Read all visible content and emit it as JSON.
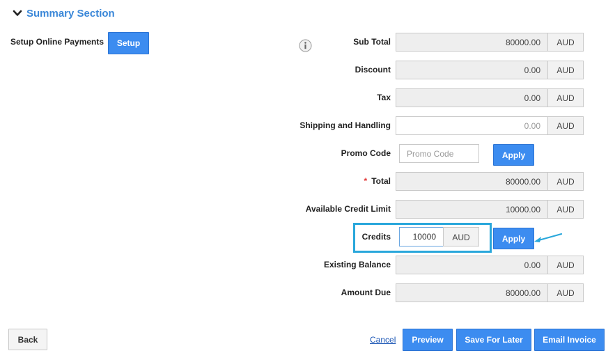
{
  "section": {
    "title": "Summary Section"
  },
  "setup": {
    "label": "Setup Online Payments",
    "button": "Setup"
  },
  "rows": {
    "sub_total": {
      "label": "Sub Total",
      "value": "80000.00",
      "unit": "AUD"
    },
    "discount": {
      "label": "Discount",
      "value": "0.00",
      "unit": "AUD"
    },
    "tax": {
      "label": "Tax",
      "value": "0.00",
      "unit": "AUD"
    },
    "shipping": {
      "label": "Shipping and Handling",
      "value": "0.00",
      "unit": "AUD"
    },
    "promo": {
      "label": "Promo Code",
      "placeholder": "Promo Code",
      "button": "Apply"
    },
    "total": {
      "label": "Total",
      "required_mark": "*",
      "value": "80000.00",
      "unit": "AUD"
    },
    "credit_limit": {
      "label": "Available Credit Limit",
      "value": "10000.00",
      "unit": "AUD"
    },
    "credits": {
      "label": "Credits",
      "value": "10000",
      "unit": "AUD",
      "button": "Apply"
    },
    "existing_balance": {
      "label": "Existing Balance",
      "value": "0.00",
      "unit": "AUD"
    },
    "amount_due": {
      "label": "Amount Due",
      "value": "80000.00",
      "unit": "AUD"
    }
  },
  "footer": {
    "back": "Back",
    "cancel": "Cancel",
    "preview": "Preview",
    "save": "Save For Later",
    "email": "Email Invoice"
  },
  "colors": {
    "accent": "#3c8cf0",
    "title": "#3a87d8",
    "highlight": "#29a7db",
    "required": "#e23b3b"
  },
  "icons": {
    "section_toggle": "chevron-down-icon",
    "info": "info-icon",
    "pointer": "arrow-left-icon"
  }
}
